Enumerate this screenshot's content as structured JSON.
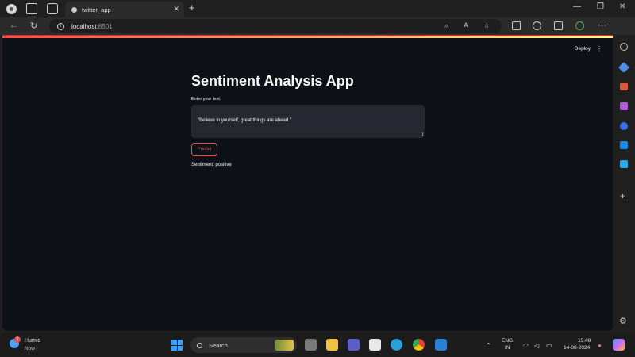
{
  "browser": {
    "tab_title": "twitter_app",
    "url_host": "localhost",
    "url_port": ":8501",
    "newtab_symbol": "+",
    "tab_close_symbol": "✕"
  },
  "streamlit": {
    "deploy_label": "Deploy",
    "menu_symbol": "⋮",
    "title": "Sentiment Analysis App",
    "input_label": "Enter your text:",
    "input_value": "\"Believe in yourself, great things are ahead.\"",
    "button_label": "Predict",
    "result": "Sentiment: positive"
  },
  "taskbar": {
    "weather_title": "Humid",
    "weather_sub": "Now",
    "weather_badge": "1",
    "search_placeholder": "Search",
    "lang_top": "ENG",
    "lang_bottom": "IN",
    "time": "15:48",
    "date": "14-08-2024"
  }
}
